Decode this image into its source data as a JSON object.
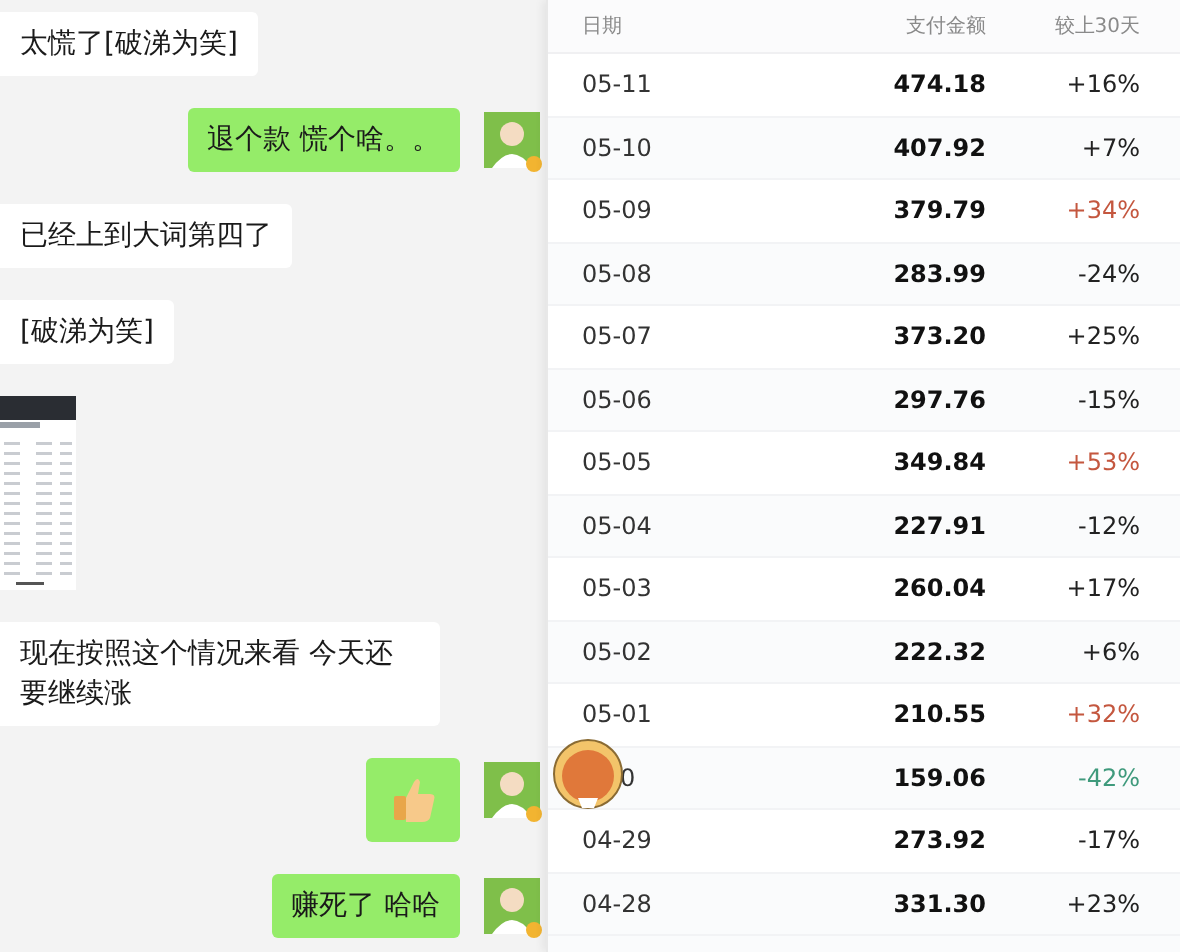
{
  "chat": {
    "messages": [
      {
        "outgoing": false,
        "kind": "text",
        "text": "太慌了[破涕为笑]"
      },
      {
        "outgoing": true,
        "kind": "text",
        "text": "退个款 慌个啥。。"
      },
      {
        "outgoing": false,
        "kind": "text",
        "text": "已经上到大词第四了"
      },
      {
        "outgoing": false,
        "kind": "text",
        "text": "[破涕为笑]"
      },
      {
        "outgoing": false,
        "kind": "image"
      },
      {
        "outgoing": false,
        "kind": "text",
        "text": "现在按照这个情况来看 今天还要继续涨"
      },
      {
        "outgoing": true,
        "kind": "emoji"
      },
      {
        "outgoing": true,
        "kind": "text",
        "text": "赚死了  哈哈"
      }
    ]
  },
  "table": {
    "columns": [
      "日期",
      "支付金额",
      "较上30天"
    ],
    "rows": [
      {
        "kind": "plain",
        "date": "05-11",
        "amount": "474.18",
        "change": "+16%",
        "color": "#222222"
      },
      {
        "kind": "plain",
        "date": "05-10",
        "amount": "407.92",
        "change": "+7%",
        "color": "#222222"
      },
      {
        "kind": "plain",
        "date": "05-09",
        "amount": "379.79",
        "change": "+34%",
        "color": "#c4573f"
      },
      {
        "kind": "plain",
        "date": "05-08",
        "amount": "283.99",
        "change": "-24%",
        "color": "#222222"
      },
      {
        "kind": "plain",
        "date": "05-07",
        "amount": "373.20",
        "change": "+25%",
        "color": "#222222"
      },
      {
        "kind": "plain",
        "date": "05-06",
        "amount": "297.76",
        "change": "-15%",
        "color": "#222222"
      },
      {
        "kind": "plain",
        "date": "05-05",
        "amount": "349.84",
        "change": "+53%",
        "color": "#c4573f"
      },
      {
        "kind": "plain",
        "date": "05-04",
        "amount": "227.91",
        "change": "-12%",
        "color": "#222222"
      },
      {
        "kind": "plain",
        "date": "05-03",
        "amount": "260.04",
        "change": "+17%",
        "color": "#222222"
      },
      {
        "kind": "plain",
        "date": "05-02",
        "amount": "222.32",
        "change": "+6%",
        "color": "#222222"
      },
      {
        "kind": "plain",
        "date": "05-01",
        "amount": "210.55",
        "change": "+32%",
        "color": "#c4573f"
      },
      {
        "kind": "covered",
        "date": "0",
        "amount": "159.06",
        "change": "-42%",
        "color": "#3f9a7c"
      },
      {
        "kind": "plain",
        "date": "04-29",
        "amount": "273.92",
        "change": "-17%",
        "color": "#222222"
      },
      {
        "kind": "plain",
        "date": "04-28",
        "amount": "331.30",
        "change": "+23%",
        "color": "#222222"
      }
    ]
  }
}
